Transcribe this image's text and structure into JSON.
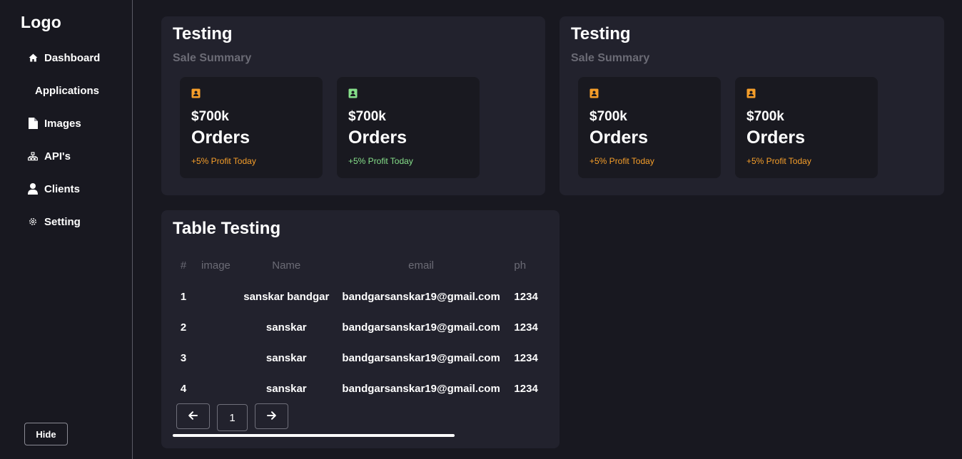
{
  "sidebar": {
    "logo": "Logo",
    "items": [
      {
        "label": "Dashboard",
        "icon": "home-icon"
      },
      {
        "label": "Applications",
        "icon": ""
      },
      {
        "label": "Images",
        "icon": "file-icon"
      },
      {
        "label": "API's",
        "icon": "sitemap-icon"
      },
      {
        "label": "Clients",
        "icon": "user-icon"
      },
      {
        "label": "Setting",
        "icon": "gear-icon"
      }
    ],
    "hide_label": "Hide"
  },
  "cards": [
    {
      "title": "Testing",
      "subtitle": "Sale Summary",
      "stats": [
        {
          "value": "$700k",
          "label": "Orders",
          "note": "+5% Profit Today",
          "color": "#f59e2a",
          "icon": "contact-icon"
        },
        {
          "value": "$700k",
          "label": "Orders",
          "note": "+5% Profit Today",
          "color": "#86e08a",
          "icon": "contact-icon"
        }
      ]
    },
    {
      "title": "Testing",
      "subtitle": "Sale Summary",
      "stats": [
        {
          "value": "$700k",
          "label": "Orders",
          "note": "+5% Profit Today",
          "color": "#f59e2a",
          "icon": "contact-icon"
        },
        {
          "value": "$700k",
          "label": "Orders",
          "note": "+5% Profit Today",
          "color": "#f59e2a",
          "icon": "contact-icon"
        }
      ]
    }
  ],
  "table": {
    "title": "Table Testing",
    "headers": [
      "#",
      "image",
      "Name",
      "email",
      "ph"
    ],
    "rows": [
      {
        "num": "1",
        "image": "",
        "name": "sanskar bandgar",
        "email": "bandgarsanskar19@gmail.com",
        "phone": "1234"
      },
      {
        "num": "2",
        "image": "",
        "name": "sanskar",
        "email": "bandgarsanskar19@gmail.com",
        "phone": "1234"
      },
      {
        "num": "3",
        "image": "",
        "name": "sanskar",
        "email": "bandgarsanskar19@gmail.com",
        "phone": "1234"
      },
      {
        "num": "4",
        "image": "",
        "name": "sanskar",
        "email": "bandgarsanskar19@gmail.com",
        "phone": "1234"
      }
    ],
    "pagination": {
      "prev_icon": "arrow-left-icon",
      "page": "1",
      "next_icon": "arrow-right-icon"
    }
  }
}
